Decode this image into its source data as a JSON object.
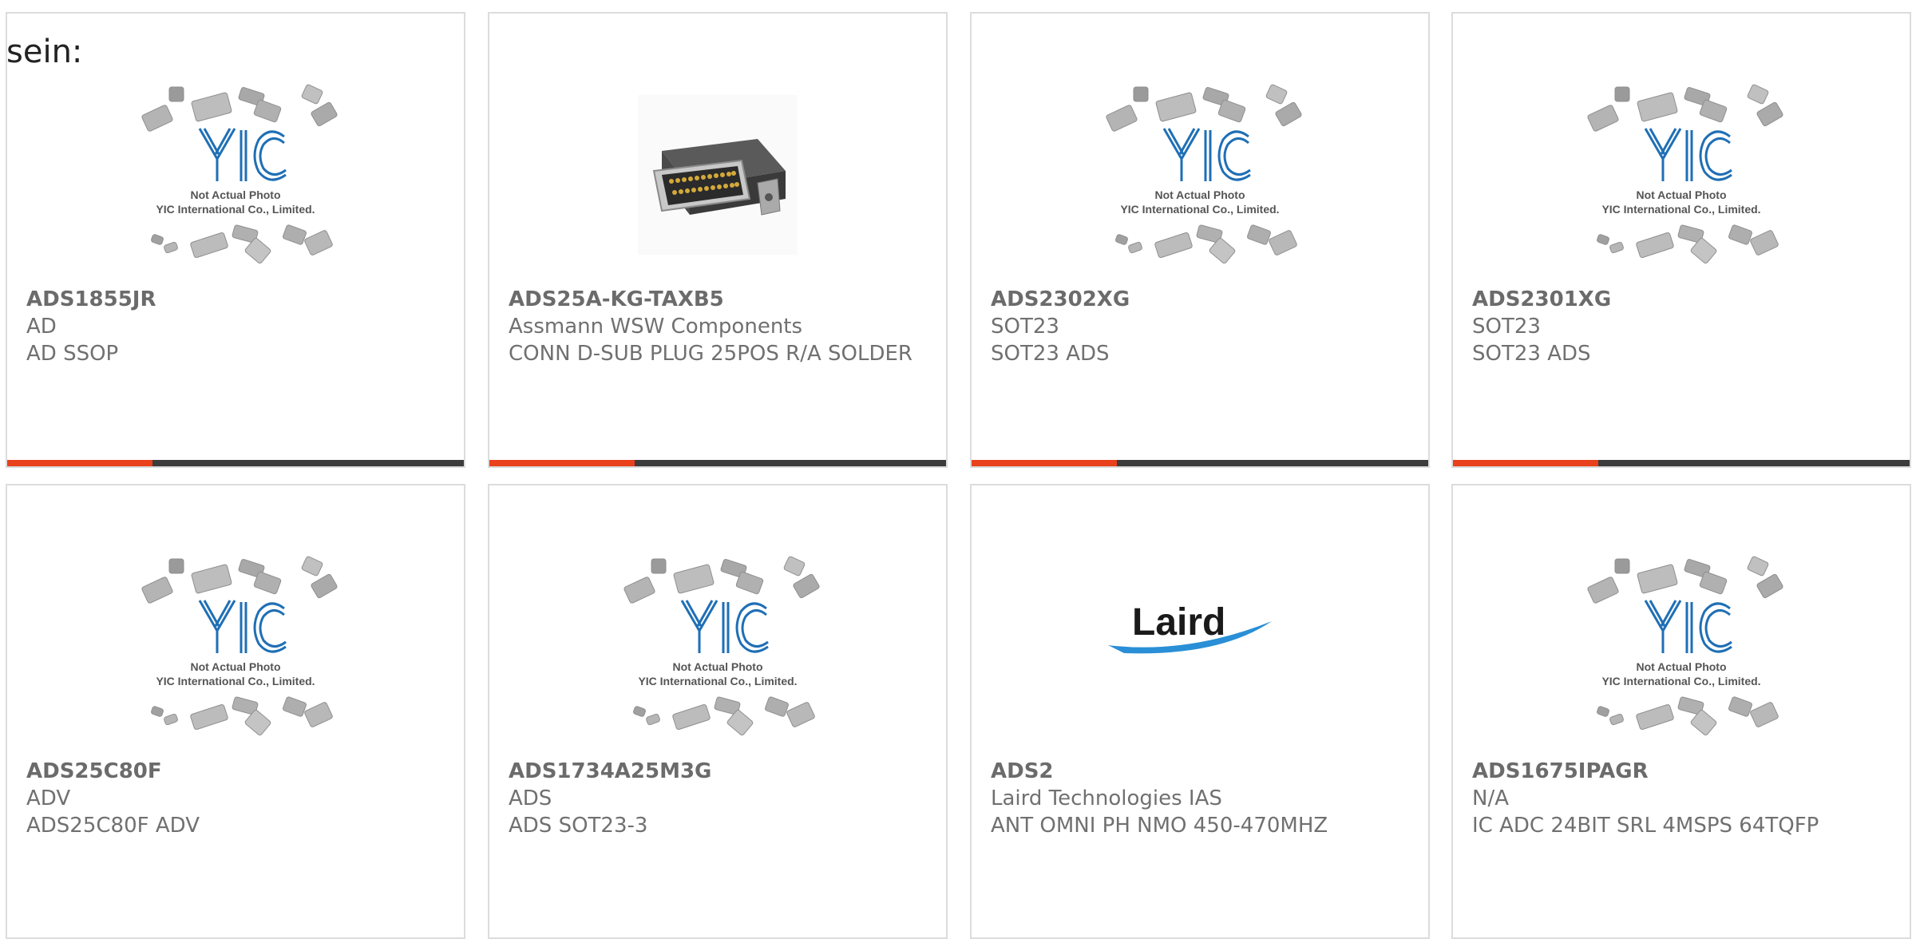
{
  "intro_text": "sein:",
  "placeholder": {
    "caption_line1": "Not Actual Photo",
    "caption_line2": "YIC International Co., Limited.",
    "logo_text": "YIC"
  },
  "laird_logo_text": "Laird",
  "colors": {
    "accent": "#e8411c",
    "bar": "#3c3c3c",
    "text": "#707070",
    "border": "#dcdcdc",
    "yic_blue": "#1f6fb5"
  },
  "products": [
    {
      "part_no": "ADS1855JR",
      "manufacturer": "AD",
      "description": "AD SSOP",
      "image": "yic-placeholder"
    },
    {
      "part_no": "ADS25A-KG-TAXB5",
      "manufacturer": "Assmann WSW Components",
      "description": "CONN D-SUB PLUG 25POS R/A SOLDER",
      "image": "dsub-connector-photo"
    },
    {
      "part_no": "ADS2302XG",
      "manufacturer": "SOT23",
      "description": "SOT23 ADS",
      "image": "yic-placeholder"
    },
    {
      "part_no": "ADS2301XG",
      "manufacturer": "SOT23",
      "description": "SOT23 ADS",
      "image": "yic-placeholder"
    },
    {
      "part_no": "ADS25C80F",
      "manufacturer": "ADV",
      "description": "ADS25C80F ADV",
      "image": "yic-placeholder"
    },
    {
      "part_no": "ADS1734A25M3G",
      "manufacturer": "ADS",
      "description": "ADS SOT23-3",
      "image": "yic-placeholder"
    },
    {
      "part_no": "ADS2",
      "manufacturer": "Laird Technologies IAS",
      "description": "ANT OMNI PH NMO 450-470MHZ",
      "image": "laird-logo"
    },
    {
      "part_no": "ADS1675IPAGR",
      "manufacturer": "N/A",
      "description": "IC ADC 24BIT SRL 4MSPS 64TQFP",
      "image": "yic-placeholder"
    }
  ]
}
